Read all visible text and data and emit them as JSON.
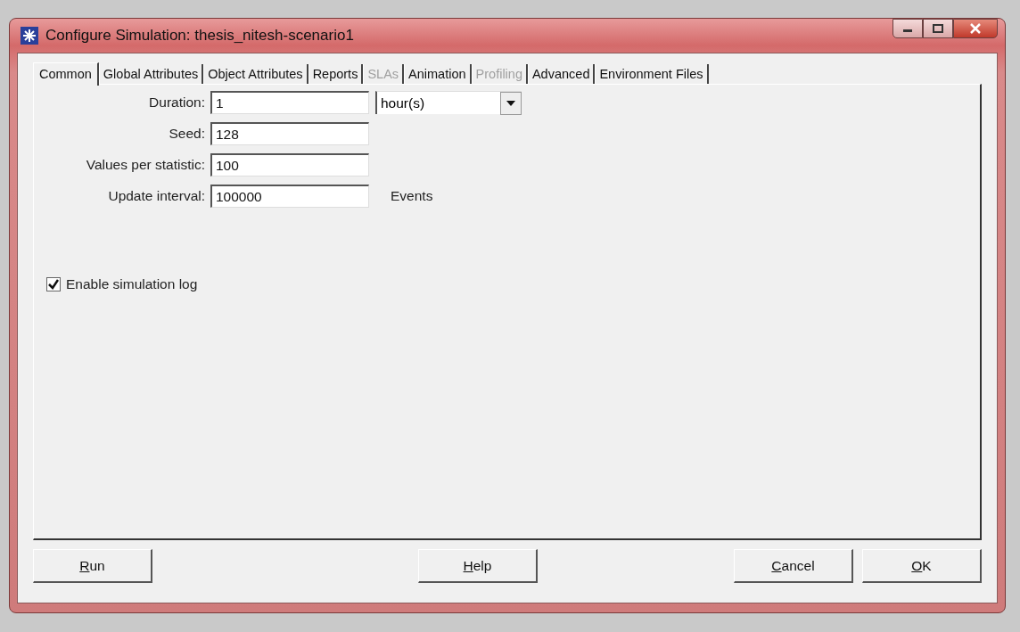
{
  "window": {
    "title": "Configure Simulation: thesis_nitesh-scenario1"
  },
  "tabs": [
    {
      "label": "Common",
      "selected": true,
      "disabled": false
    },
    {
      "label": "Global Attributes",
      "selected": false,
      "disabled": false
    },
    {
      "label": "Object Attributes",
      "selected": false,
      "disabled": false
    },
    {
      "label": "Reports",
      "selected": false,
      "disabled": false
    },
    {
      "label": "SLAs",
      "selected": false,
      "disabled": true
    },
    {
      "label": "Animation",
      "selected": false,
      "disabled": false
    },
    {
      "label": "Profiling",
      "selected": false,
      "disabled": true
    },
    {
      "label": "Advanced",
      "selected": false,
      "disabled": false
    },
    {
      "label": "Environment Files",
      "selected": false,
      "disabled": false
    }
  ],
  "fields": [
    {
      "label": "Duration:",
      "value": "1",
      "unit_dropdown": "hour(s)"
    },
    {
      "label": "Seed:",
      "value": "128"
    },
    {
      "label": "Values per statistic:",
      "value": "100"
    },
    {
      "label": "Update interval:",
      "value": "100000",
      "suffix": "Events"
    }
  ],
  "checkbox": {
    "label": "Enable simulation log",
    "checked": true
  },
  "buttons": [
    "Run",
    "Help",
    "Cancel",
    "OK"
  ]
}
